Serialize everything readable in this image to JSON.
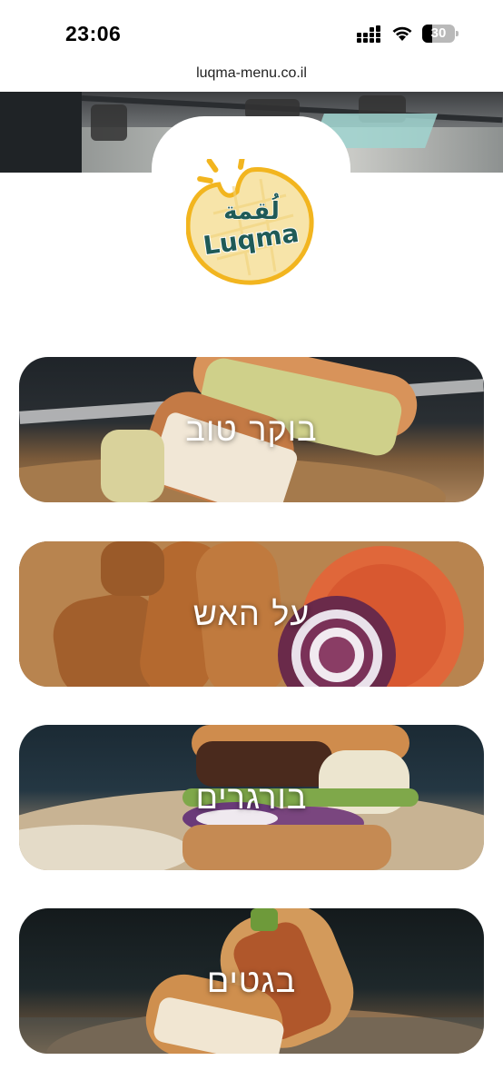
{
  "status_bar": {
    "time": "23:06",
    "battery": "30",
    "battery_level_percent": 30,
    "icons": [
      "cellular-signal-icon",
      "wifi-icon",
      "battery-icon"
    ]
  },
  "browser": {
    "url": "luqma-menu.co.il"
  },
  "brand": {
    "logo_text": "Luqma",
    "logo_arabic": "لُقمة",
    "colors": {
      "logo_yellow": "#f2b51f",
      "logo_teal": "#1f5a57",
      "logo_cream": "#f7e4a9"
    }
  },
  "categories": [
    {
      "label": "בוקר טוב"
    },
    {
      "label": "על האש"
    },
    {
      "label": "בורגרים"
    },
    {
      "label": "בגטים"
    }
  ]
}
